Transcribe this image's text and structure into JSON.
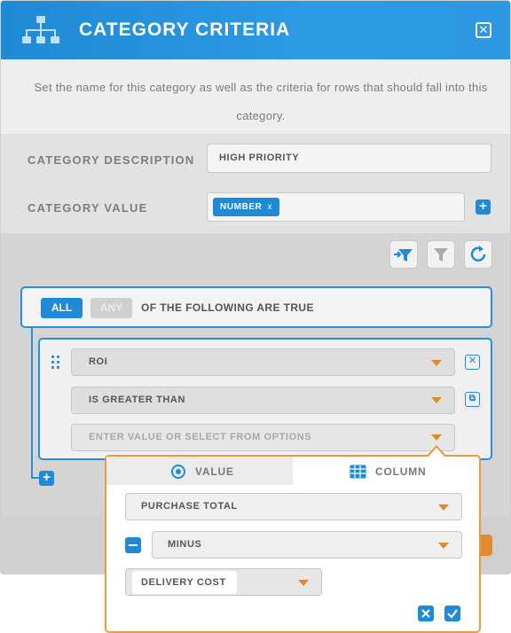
{
  "dialog": {
    "title": "CATEGORY CRITERIA",
    "description": "Set the name for this category as well as the criteria for rows that should fall into this category."
  },
  "fields": {
    "category_description_label": "CATEGORY DESCRIPTION",
    "category_description_value": "HIGH PRIORITY",
    "category_value_label": "CATEGORY VALUE",
    "category_value_chip": "NUMBER",
    "chip_remove": "x"
  },
  "group": {
    "all_label": "ALL",
    "any_label": "ANY",
    "selected": "ALL",
    "text": "OF THE FOLLOWING ARE TRUE"
  },
  "criteria": {
    "field": "ROI",
    "operator": "IS GREATER THAN",
    "value_placeholder": "ENTER VALUE OR SELECT FROM OPTIONS"
  },
  "popover": {
    "tabs": [
      {
        "label": "VALUE",
        "icon": "radio-icon"
      },
      {
        "label": "COLUMN",
        "icon": "table-icon"
      }
    ],
    "column": "PURCHASE TOTAL",
    "operation": "MINUS",
    "second_column": "DELIVERY COST"
  },
  "colors": {
    "primary": "#1f8ad6",
    "accent": "#e0892e"
  }
}
